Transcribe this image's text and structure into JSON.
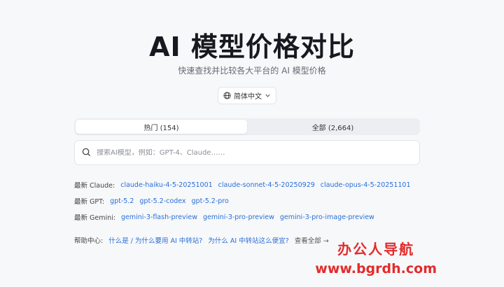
{
  "header": {
    "title": "AI 模型价格对比",
    "subtitle": "快速查找并比较各大平台的 AI 模型价格"
  },
  "language": {
    "selected": "简体中文",
    "icon": "globe-icon"
  },
  "tabs": [
    {
      "label": "热门 (154)",
      "active": true
    },
    {
      "label": "全部 (2,664)",
      "active": false
    }
  ],
  "search": {
    "placeholder": "搜索AI模型，例如：GPT-4、Claude……",
    "value": ""
  },
  "latest": [
    {
      "label": "最新 Claude:",
      "links": [
        "claude-haiku-4-5-20251001",
        "claude-sonnet-4-5-20250929",
        "claude-opus-4-5-20251101"
      ]
    },
    {
      "label": "最新 GPT:",
      "links": [
        "gpt-5.2",
        "gpt-5.2-codex",
        "gpt-5.2-pro"
      ]
    },
    {
      "label": "最新 Gemini:",
      "links": [
        "gemini-3-flash-preview",
        "gemini-3-pro-preview",
        "gemini-3-pro-image-preview"
      ]
    }
  ],
  "help": {
    "label": "帮助中心:",
    "links": [
      "什么是 / 为什么要用 AI 中转站?",
      "为什么 AI 中转站这么便宜?"
    ],
    "view_all": "查看全部 →"
  },
  "watermark": {
    "line1": "办公人导航",
    "line2": "www.bgrdh.com"
  }
}
